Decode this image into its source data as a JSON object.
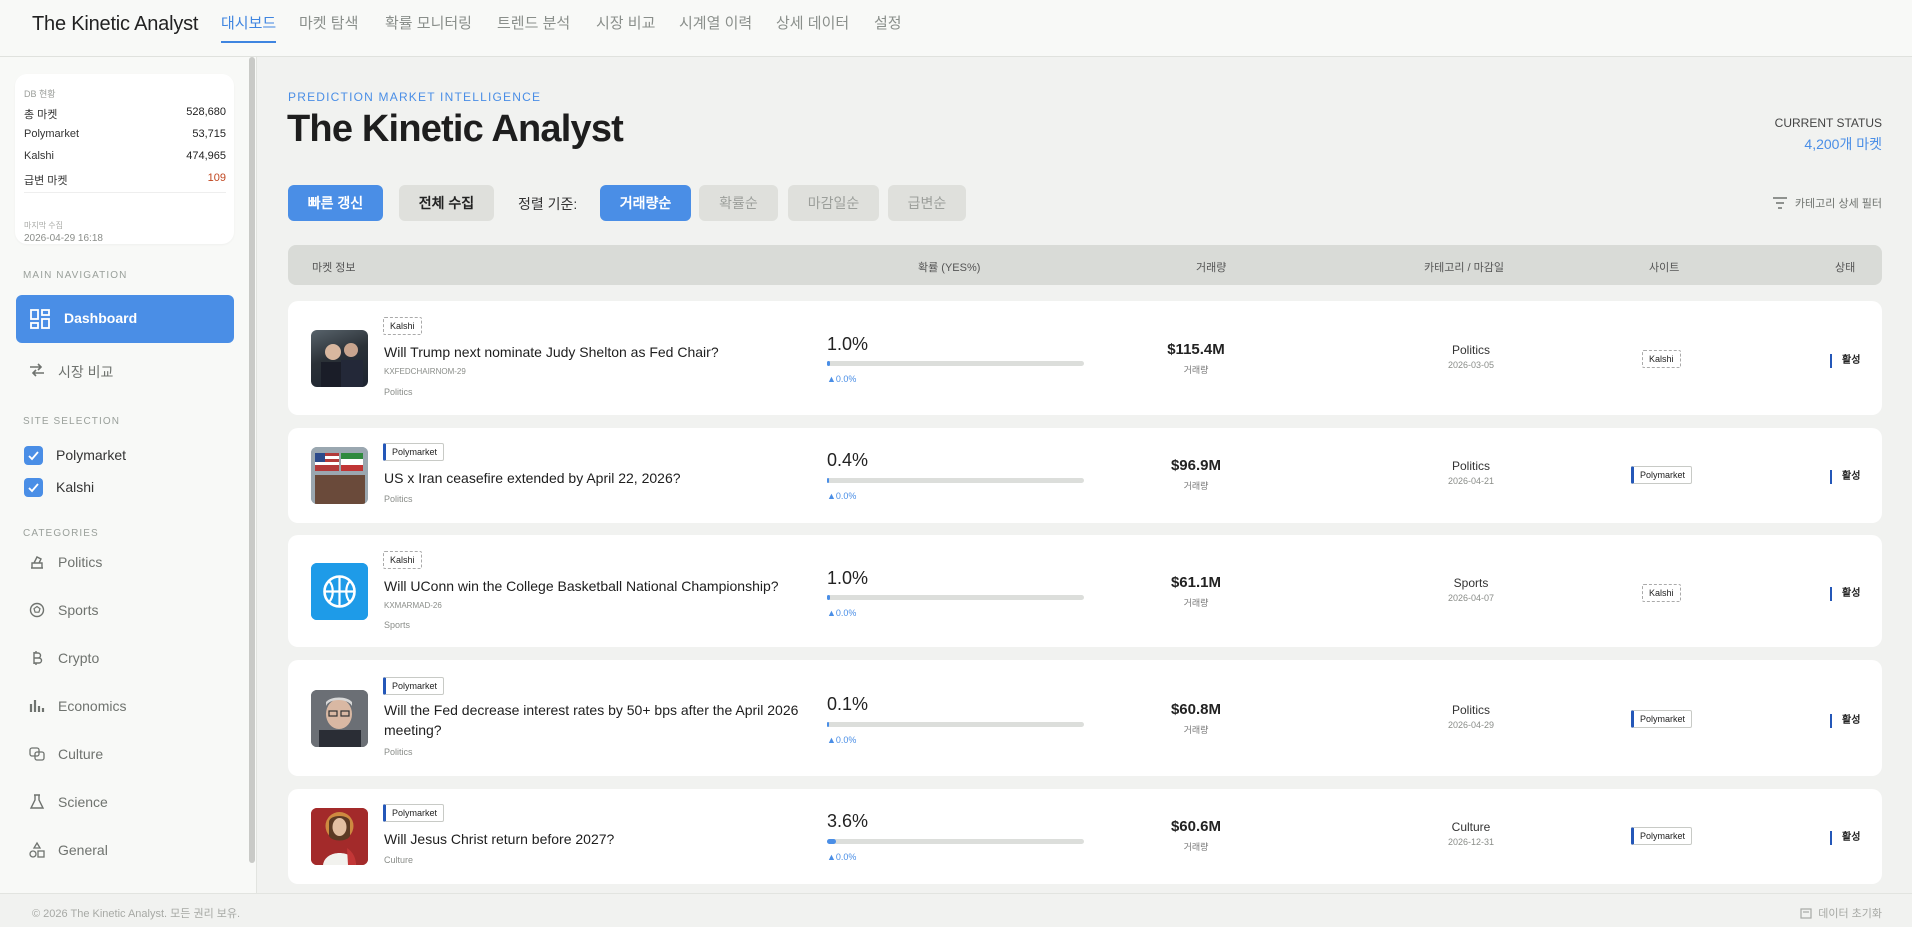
{
  "brand": "The Kinetic Analyst",
  "nav_tabs": [
    "대시보드",
    "마켓 탐색",
    "확률 모니터링",
    "트렌드 분석",
    "시장 비교",
    "시계열 이력",
    "상세 데이터",
    "설정"
  ],
  "db": {
    "title": "DB 현황",
    "rows": [
      {
        "label": "총 마켓",
        "value": "528,680"
      },
      {
        "label": "Polymarket",
        "value": "53,715"
      },
      {
        "label": "Kalshi",
        "value": "474,965"
      },
      {
        "label": "급변 마켓",
        "value": "109"
      }
    ],
    "last_label": "마지막 수집",
    "last_value": "2026-04-29 16:18"
  },
  "sidebar": {
    "main_nav_label": "MAIN NAVIGATION",
    "dashboard": "Dashboard",
    "compare": "시장 비교",
    "site_label": "SITE SELECTION",
    "sites": [
      "Polymarket",
      "Kalshi"
    ],
    "categories_label": "CATEGORIES",
    "categories": [
      "Politics",
      "Sports",
      "Crypto",
      "Economics",
      "Culture",
      "Science",
      "General"
    ]
  },
  "header": {
    "eyebrow": "PREDICTION MARKET INTELLIGENCE",
    "title": "The Kinetic Analyst",
    "status_label": "CURRENT STATUS",
    "status_value": "4,200개 마켓"
  },
  "toolbar": {
    "quick_refresh": "빠른 갱신",
    "full_collect": "전체 수집",
    "sort_label": "정렬 기준:",
    "sort_options": [
      "거래량순",
      "확률순",
      "마감일순",
      "급변순"
    ],
    "filter": "카테고리 상세 필터"
  },
  "table_headers": [
    "마켓 정보",
    "확률 (YES%)",
    "거래량",
    "카테고리 / 마감일",
    "사이트",
    "상태"
  ],
  "volume_label": "거래량",
  "rows": [
    {
      "site": "Kalshi",
      "question": "Will Trump next nominate Judy Shelton as Fed Chair?",
      "ticker": "KXFEDCHAIRNOM-29",
      "category": "Politics",
      "prob": "1.0%",
      "prob_value": 1.0,
      "delta": "▲0.0%",
      "volume": "$115.4M",
      "close": "2026-03-05",
      "state": "활성"
    },
    {
      "site": "Polymarket",
      "question": "US x Iran ceasefire extended by April 22, 2026?",
      "ticker": "",
      "category": "Politics",
      "prob": "0.4%",
      "prob_value": 0.4,
      "delta": "▲0.0%",
      "volume": "$96.9M",
      "close": "2026-04-21",
      "state": "활성"
    },
    {
      "site": "Kalshi",
      "question": "Will UConn win the College Basketball National Championship?",
      "ticker": "KXMARMAD-26",
      "category": "Sports",
      "prob": "1.0%",
      "prob_value": 1.0,
      "delta": "▲0.0%",
      "volume": "$61.1M",
      "close": "2026-04-07",
      "state": "활성"
    },
    {
      "site": "Polymarket",
      "question": "Will the Fed decrease interest rates by 50+ bps after the April 2026 meeting?",
      "ticker": "",
      "category": "Politics",
      "prob": "0.1%",
      "prob_value": 0.1,
      "delta": "▲0.0%",
      "volume": "$60.8M",
      "close": "2026-04-29",
      "state": "활성"
    },
    {
      "site": "Polymarket",
      "question": "Will Jesus Christ return before 2027?",
      "ticker": "",
      "category": "Culture",
      "prob": "3.6%",
      "prob_value": 3.6,
      "delta": "▲0.0%",
      "volume": "$60.6M",
      "close": "2026-12-31",
      "state": "활성"
    }
  ],
  "footer": {
    "copyright": "© 2026 The Kinetic Analyst. 모든 권리 보유.",
    "reset": "데이터 초기화"
  },
  "colors": {
    "accent": "#4a8ee6",
    "warn": "#c0461f",
    "poly_bar": "#2457b8"
  }
}
